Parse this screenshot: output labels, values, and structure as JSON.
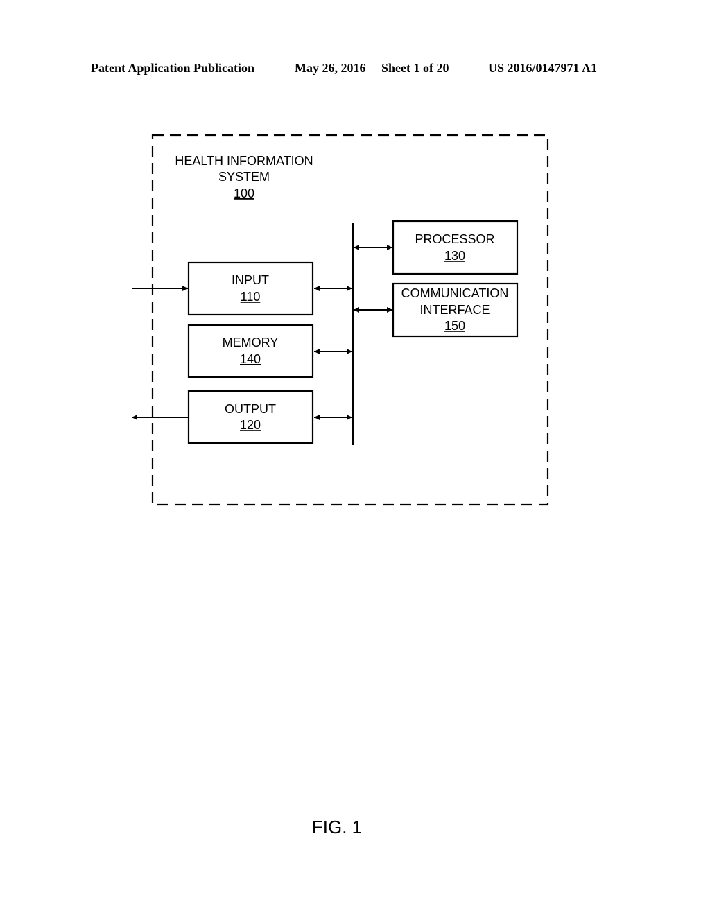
{
  "header": {
    "publication": "Patent Application Publication",
    "date": "May 26, 2016",
    "sheet": "Sheet 1 of 20",
    "number": "US 2016/0147971 A1"
  },
  "system": {
    "title_line1": "HEALTH INFORMATION",
    "title_line2": "SYSTEM",
    "ref": "100"
  },
  "blocks": {
    "input": {
      "label": "INPUT",
      "ref": "110"
    },
    "memory": {
      "label": "MEMORY",
      "ref": "140"
    },
    "output": {
      "label": "OUTPUT",
      "ref": "120"
    },
    "processor": {
      "label": "PROCESSOR",
      "ref": "130"
    },
    "comm": {
      "label_line1": "COMMUNICATION",
      "label_line2": "INTERFACE",
      "ref": "150"
    }
  },
  "figure_label": "FIG. 1"
}
